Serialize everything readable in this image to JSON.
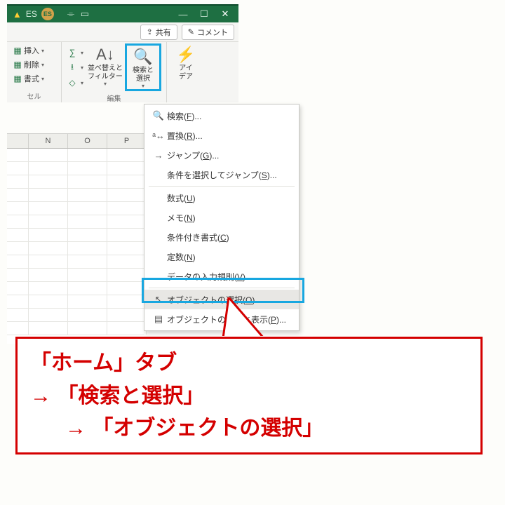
{
  "titlebar": {
    "es_text": "ES",
    "es_badge": "ES"
  },
  "sharebar": {
    "share": "共有",
    "comment": "コメント"
  },
  "ribbon": {
    "cells": {
      "insert": "挿入",
      "delete": "削除",
      "format": "書式",
      "label": "セル"
    },
    "editing": {
      "sort": "並べ替えと\nフィルター",
      "find": "検索と\n選択",
      "label": "編集"
    },
    "ideas": {
      "ideas": "アイ\nデア"
    }
  },
  "columns": [
    "",
    "N",
    "O",
    "P"
  ],
  "menu": {
    "find": "検索(F)...",
    "replace": "置換(R)...",
    "goto": "ジャンプ(G)...",
    "gospecial": "条件を選択してジャンプ(S)...",
    "formulas": "数式(U)",
    "notes": "メモ(N)",
    "condfmt": "条件付き書式(C)",
    "constants": "定数(N)",
    "validation": "データの入力規則(V)...",
    "selobj": "オブジェクトの選択(O)",
    "selpane": "オブジェクトの選択と表示(P)..."
  },
  "callout": {
    "line1": "「ホーム」タブ",
    "line2": "→ 「検索と選択」",
    "line3": "→ 「オブジェクトの選択」"
  }
}
